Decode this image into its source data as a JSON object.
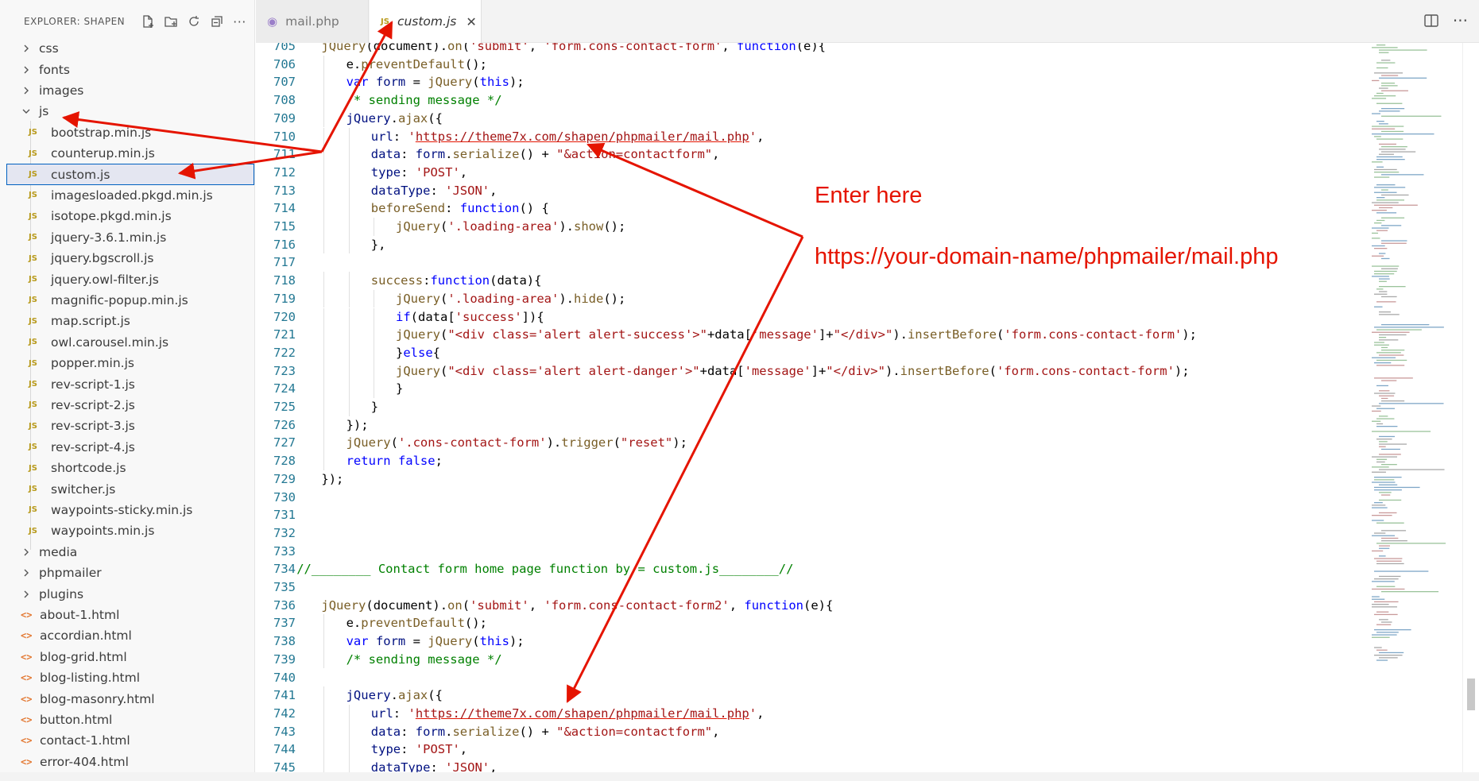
{
  "sidebar": {
    "title": "EXPLORER: SHAPEN",
    "header_icons": [
      "new-file-icon",
      "new-folder-icon",
      "refresh-icon",
      "collapse-all-icon",
      "more-icon"
    ],
    "items": [
      {
        "label": "css",
        "kind": "folder",
        "expanded": false
      },
      {
        "label": "fonts",
        "kind": "folder",
        "expanded": false
      },
      {
        "label": "images",
        "kind": "folder",
        "expanded": false
      },
      {
        "label": "js",
        "kind": "folder",
        "expanded": true
      },
      {
        "label": "bootstrap.min.js",
        "kind": "js"
      },
      {
        "label": "counterup.min.js",
        "kind": "js"
      },
      {
        "label": "custom.js",
        "kind": "js",
        "selected": true
      },
      {
        "label": "imagesloaded.pkgd.min.js",
        "kind": "js"
      },
      {
        "label": "isotope.pkgd.min.js",
        "kind": "js"
      },
      {
        "label": "jquery-3.6.1.min.js",
        "kind": "js"
      },
      {
        "label": "jquery.bgscroll.js",
        "kind": "js"
      },
      {
        "label": "jquery.owl-filter.js",
        "kind": "js"
      },
      {
        "label": "magnific-popup.min.js",
        "kind": "js"
      },
      {
        "label": "map.script.js",
        "kind": "js"
      },
      {
        "label": "owl.carousel.min.js",
        "kind": "js"
      },
      {
        "label": "popper.min.js",
        "kind": "js"
      },
      {
        "label": "rev-script-1.js",
        "kind": "js"
      },
      {
        "label": "rev-script-2.js",
        "kind": "js"
      },
      {
        "label": "rev-script-3.js",
        "kind": "js"
      },
      {
        "label": "rev-script-4.js",
        "kind": "js"
      },
      {
        "label": "shortcode.js",
        "kind": "js"
      },
      {
        "label": "switcher.js",
        "kind": "js"
      },
      {
        "label": "waypoints-sticky.min.js",
        "kind": "js"
      },
      {
        "label": "waypoints.min.js",
        "kind": "js"
      },
      {
        "label": "media",
        "kind": "folder",
        "expanded": false
      },
      {
        "label": "phpmailer",
        "kind": "folder",
        "expanded": false
      },
      {
        "label": "plugins",
        "kind": "folder",
        "expanded": false
      },
      {
        "label": "about-1.html",
        "kind": "html"
      },
      {
        "label": "accordian.html",
        "kind": "html"
      },
      {
        "label": "blog-grid.html",
        "kind": "html"
      },
      {
        "label": "blog-listing.html",
        "kind": "html"
      },
      {
        "label": "blog-masonry.html",
        "kind": "html"
      },
      {
        "label": "button.html",
        "kind": "html"
      },
      {
        "label": "contact-1.html",
        "kind": "html"
      },
      {
        "label": "error-404.html",
        "kind": "html"
      }
    ]
  },
  "tabs": [
    {
      "label": "mail.php",
      "icon": "php-elephant-icon",
      "active": false
    },
    {
      "label": "custom.js",
      "icon": "js-icon",
      "active": true,
      "close": "✕"
    }
  ],
  "js_icon_text": "JS",
  "html_icon_text": "<>",
  "editor": {
    "lines": [
      {
        "n": "705",
        "i": 2,
        "t": [
          [
            "jq",
            "jQuery"
          ],
          [
            "p",
            "(document)."
          ],
          [
            "jq",
            "on"
          ],
          [
            "p",
            "("
          ],
          [
            "str",
            "'submit'"
          ],
          [
            "p",
            ", "
          ],
          [
            "str",
            "'form.cons-contact-form'"
          ],
          [
            "p",
            ", "
          ],
          [
            "kw",
            "function"
          ],
          [
            "p",
            "(e){"
          ]
        ]
      },
      {
        "n": "706",
        "i": 3,
        "t": [
          [
            "p",
            "e."
          ],
          [
            "jq",
            "preventDefault"
          ],
          [
            "p",
            "();"
          ]
        ]
      },
      {
        "n": "707",
        "i": 3,
        "t": [
          [
            "kw",
            "var"
          ],
          [
            "p",
            " "
          ],
          [
            "prop",
            "form"
          ],
          [
            "p",
            " = "
          ],
          [
            "jq",
            "jQuery"
          ],
          [
            "p",
            "("
          ],
          [
            "kw",
            "this"
          ],
          [
            "p",
            ");"
          ]
        ]
      },
      {
        "n": "708",
        "i": 3,
        "t": [
          [
            "com",
            "/* sending message */"
          ]
        ]
      },
      {
        "n": "709",
        "i": 3,
        "t": [
          [
            "prop",
            "jQuery"
          ],
          [
            "p",
            "."
          ],
          [
            "jq",
            "ajax"
          ],
          [
            "p",
            "({"
          ]
        ]
      },
      {
        "n": "710",
        "i": 4,
        "t": [
          [
            "prop",
            "url"
          ],
          [
            "p",
            ": "
          ],
          [
            "str",
            "'"
          ],
          [
            "url",
            "https://theme7x.com/shapen/phpmailer/mail.php"
          ],
          [
            "str",
            "'"
          ],
          [
            "p",
            ","
          ]
        ]
      },
      {
        "n": "711",
        "i": 4,
        "t": [
          [
            "prop",
            "data"
          ],
          [
            "p",
            ": "
          ],
          [
            "prop",
            "form"
          ],
          [
            "p",
            "."
          ],
          [
            "jq",
            "serialize"
          ],
          [
            "p",
            "() + "
          ],
          [
            "str",
            "\"&action=contactform\""
          ],
          [
            "p",
            ","
          ]
        ]
      },
      {
        "n": "712",
        "i": 4,
        "t": [
          [
            "prop",
            "type"
          ],
          [
            "p",
            ": "
          ],
          [
            "str",
            "'POST'"
          ],
          [
            "p",
            ","
          ]
        ]
      },
      {
        "n": "713",
        "i": 4,
        "t": [
          [
            "prop",
            "dataType"
          ],
          [
            "p",
            ": "
          ],
          [
            "str",
            "'JSON'"
          ],
          [
            "p",
            ","
          ]
        ]
      },
      {
        "n": "714",
        "i": 4,
        "t": [
          [
            "jq",
            "beforeSend"
          ],
          [
            "p",
            ": "
          ],
          [
            "kw",
            "function"
          ],
          [
            "p",
            "() {"
          ]
        ]
      },
      {
        "n": "715",
        "i": 5,
        "t": [
          [
            "jq",
            "jQuery"
          ],
          [
            "p",
            "("
          ],
          [
            "str",
            "'.loading-area'"
          ],
          [
            "p",
            ")."
          ],
          [
            "jq",
            "show"
          ],
          [
            "p",
            "();"
          ]
        ]
      },
      {
        "n": "716",
        "i": 4,
        "t": [
          [
            "p",
            "},"
          ]
        ]
      },
      {
        "n": "717",
        "i": 0,
        "t": []
      },
      {
        "n": "718",
        "i": 4,
        "t": [
          [
            "jq",
            "success"
          ],
          [
            "p",
            ":"
          ],
          [
            "kw",
            "function"
          ],
          [
            "p",
            "(data){"
          ]
        ]
      },
      {
        "n": "719",
        "i": 5,
        "t": [
          [
            "jq",
            "jQuery"
          ],
          [
            "p",
            "("
          ],
          [
            "str",
            "'.loading-area'"
          ],
          [
            "p",
            ")."
          ],
          [
            "jq",
            "hide"
          ],
          [
            "p",
            "();"
          ]
        ]
      },
      {
        "n": "720",
        "i": 5,
        "t": [
          [
            "kw",
            "if"
          ],
          [
            "p",
            "(data["
          ],
          [
            "str",
            "'success'"
          ],
          [
            "p",
            "]){"
          ]
        ]
      },
      {
        "n": "721",
        "i": 5,
        "t": [
          [
            "jq",
            "jQuery"
          ],
          [
            "p",
            "("
          ],
          [
            "str",
            "\"<div class='alert alert-success'>\""
          ],
          [
            "p",
            "+data["
          ],
          [
            "str",
            "'message'"
          ],
          [
            "p",
            "]+"
          ],
          [
            "str",
            "\"</div>\""
          ],
          [
            "p",
            ")."
          ],
          [
            "jq",
            "insertBefore"
          ],
          [
            "p",
            "("
          ],
          [
            "str",
            "'form.cons-contact-form'"
          ],
          [
            "p",
            ");"
          ]
        ]
      },
      {
        "n": "722",
        "i": 5,
        "t": [
          [
            "p",
            "}"
          ],
          [
            "kw",
            "else"
          ],
          [
            "p",
            "{"
          ]
        ]
      },
      {
        "n": "723",
        "i": 5,
        "t": [
          [
            "jq",
            "jQuery"
          ],
          [
            "p",
            "("
          ],
          [
            "str",
            "\"<div class='alert alert-danger'>\""
          ],
          [
            "p",
            "+data["
          ],
          [
            "str",
            "'message'"
          ],
          [
            "p",
            "]+"
          ],
          [
            "str",
            "\"</div>\""
          ],
          [
            "p",
            ")."
          ],
          [
            "jq",
            "insertBefore"
          ],
          [
            "p",
            "("
          ],
          [
            "str",
            "'form.cons-contact-form'"
          ],
          [
            "p",
            ");"
          ]
        ]
      },
      {
        "n": "724",
        "i": 5,
        "t": [
          [
            "p",
            "}"
          ]
        ]
      },
      {
        "n": "725",
        "i": 4,
        "t": [
          [
            "p",
            "}"
          ]
        ]
      },
      {
        "n": "726",
        "i": 3,
        "t": [
          [
            "p",
            "});"
          ]
        ]
      },
      {
        "n": "727",
        "i": 3,
        "t": [
          [
            "jq",
            "jQuery"
          ],
          [
            "p",
            "("
          ],
          [
            "str",
            "'.cons-contact-form'"
          ],
          [
            "p",
            ")."
          ],
          [
            "jq",
            "trigger"
          ],
          [
            "p",
            "("
          ],
          [
            "str",
            "\"reset\""
          ],
          [
            "p",
            ");"
          ]
        ]
      },
      {
        "n": "728",
        "i": 3,
        "t": [
          [
            "kw",
            "return"
          ],
          [
            "p",
            " "
          ],
          [
            "kw",
            "false"
          ],
          [
            "p",
            ";"
          ]
        ]
      },
      {
        "n": "729",
        "i": 2,
        "t": [
          [
            "p",
            "});"
          ]
        ]
      },
      {
        "n": "730",
        "i": 0,
        "t": []
      },
      {
        "n": "731",
        "i": 0,
        "t": []
      },
      {
        "n": "732",
        "i": 0,
        "t": []
      },
      {
        "n": "733",
        "i": 0,
        "t": []
      },
      {
        "n": "734",
        "i": 1,
        "t": [
          [
            "com",
            "//________ Contact form home page function by = custom.js________//"
          ]
        ]
      },
      {
        "n": "735",
        "i": 0,
        "t": []
      },
      {
        "n": "736",
        "i": 2,
        "t": [
          [
            "jq",
            "jQuery"
          ],
          [
            "p",
            "(document)."
          ],
          [
            "jq",
            "on"
          ],
          [
            "p",
            "("
          ],
          [
            "str",
            "'submit'"
          ],
          [
            "p",
            ", "
          ],
          [
            "str",
            "'form.cons-contact-form2'"
          ],
          [
            "p",
            ", "
          ],
          [
            "kw",
            "function"
          ],
          [
            "p",
            "(e){"
          ]
        ]
      },
      {
        "n": "737",
        "i": 3,
        "t": [
          [
            "p",
            "e."
          ],
          [
            "jq",
            "preventDefault"
          ],
          [
            "p",
            "();"
          ]
        ]
      },
      {
        "n": "738",
        "i": 3,
        "t": [
          [
            "kw",
            "var"
          ],
          [
            "p",
            " "
          ],
          [
            "prop",
            "form"
          ],
          [
            "p",
            " = "
          ],
          [
            "jq",
            "jQuery"
          ],
          [
            "p",
            "("
          ],
          [
            "kw",
            "this"
          ],
          [
            "p",
            ");"
          ]
        ]
      },
      {
        "n": "739",
        "i": 3,
        "t": [
          [
            "com",
            "/* sending message */"
          ]
        ]
      },
      {
        "n": "740",
        "i": 0,
        "t": []
      },
      {
        "n": "741",
        "i": 3,
        "t": [
          [
            "prop",
            "jQuery"
          ],
          [
            "p",
            "."
          ],
          [
            "jq",
            "ajax"
          ],
          [
            "p",
            "({"
          ]
        ]
      },
      {
        "n": "742",
        "i": 4,
        "t": [
          [
            "prop",
            "url"
          ],
          [
            "p",
            ": "
          ],
          [
            "str",
            "'"
          ],
          [
            "url",
            "https://theme7x.com/shapen/phpmailer/mail.php"
          ],
          [
            "str",
            "'"
          ],
          [
            "p",
            ","
          ]
        ]
      },
      {
        "n": "743",
        "i": 4,
        "t": [
          [
            "prop",
            "data"
          ],
          [
            "p",
            ": "
          ],
          [
            "prop",
            "form"
          ],
          [
            "p",
            "."
          ],
          [
            "jq",
            "serialize"
          ],
          [
            "p",
            "() + "
          ],
          [
            "str",
            "\"&action=contactform\""
          ],
          [
            "p",
            ","
          ]
        ]
      },
      {
        "n": "744",
        "i": 4,
        "t": [
          [
            "prop",
            "type"
          ],
          [
            "p",
            ": "
          ],
          [
            "str",
            "'POST'"
          ],
          [
            "p",
            ","
          ]
        ]
      },
      {
        "n": "745",
        "i": 4,
        "t": [
          [
            "prop",
            "dataType"
          ],
          [
            "p",
            ": "
          ],
          [
            "str",
            "'JSON'"
          ],
          [
            "p",
            ","
          ]
        ]
      }
    ]
  },
  "annotations": {
    "enter_here": "Enter here",
    "url_hint": "https://your-domain-name/phpmailer/mail.php",
    "color": "#e51400"
  }
}
